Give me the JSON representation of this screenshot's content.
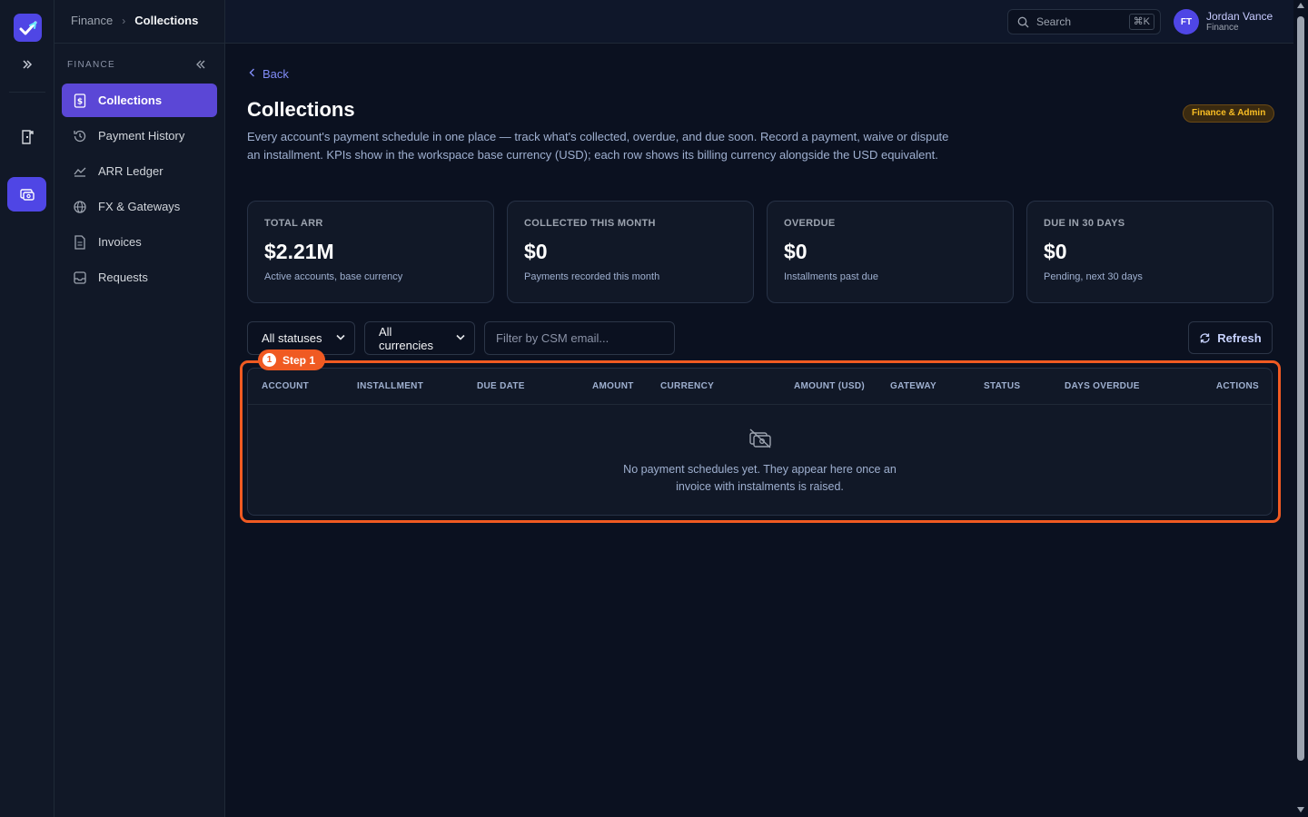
{
  "topbar": {
    "breadcrumb_root": "Finance",
    "breadcrumb_current": "Collections",
    "search_label": "Search",
    "search_shortcut": "⌘K",
    "user": {
      "initials": "FT",
      "name": "Jordan Vance",
      "role": "Finance"
    }
  },
  "sidebar": {
    "section_label": "FINANCE",
    "items": [
      {
        "label": "Collections",
        "icon": "dollar-document-icon",
        "active": true
      },
      {
        "label": "Payment History",
        "icon": "history-icon",
        "active": false
      },
      {
        "label": "ARR Ledger",
        "icon": "line-chart-icon",
        "active": false
      },
      {
        "label": "FX & Gateways",
        "icon": "globe-icon",
        "active": false
      },
      {
        "label": "Invoices",
        "icon": "invoice-icon",
        "active": false
      },
      {
        "label": "Requests",
        "icon": "inbox-icon",
        "active": false
      }
    ]
  },
  "page": {
    "back_label": "Back",
    "title": "Collections",
    "badge": "Finance & Admin",
    "description": "Every account's payment schedule in one place — track what's collected, overdue, and due soon. Record a payment, waive or dispute an installment. KPIs show in the workspace base currency (USD); each row shows its billing currency alongside the USD equivalent."
  },
  "kpis": [
    {
      "label": "TOTAL ARR",
      "value": "$2.21M",
      "sub": "Active accounts, base currency"
    },
    {
      "label": "COLLECTED THIS MONTH",
      "value": "$0",
      "sub": "Payments recorded this month"
    },
    {
      "label": "OVERDUE",
      "value": "$0",
      "sub": "Installments past due"
    },
    {
      "label": "DUE IN 30 DAYS",
      "value": "$0",
      "sub": "Pending, next 30 days"
    }
  ],
  "filters": {
    "status_selected": "All statuses",
    "currency_selected": "All currencies",
    "csm_placeholder": "Filter by CSM email...",
    "refresh_label": "Refresh"
  },
  "step": {
    "number": "1",
    "label": "Step 1"
  },
  "table": {
    "columns": [
      "ACCOUNT",
      "INSTALLMENT",
      "DUE DATE",
      "AMOUNT",
      "CURRENCY",
      "AMOUNT (USD)",
      "GATEWAY",
      "STATUS",
      "DAYS OVERDUE",
      "ACTIONS"
    ],
    "rows": [],
    "empty_message": "No payment schedules yet. They appear here once an invoice with instalments is raised."
  },
  "colors": {
    "accent": "#4f46e5",
    "active_nav": "#5b47d6",
    "highlight": "#f05a22",
    "badge_text": "#fbbf24"
  }
}
